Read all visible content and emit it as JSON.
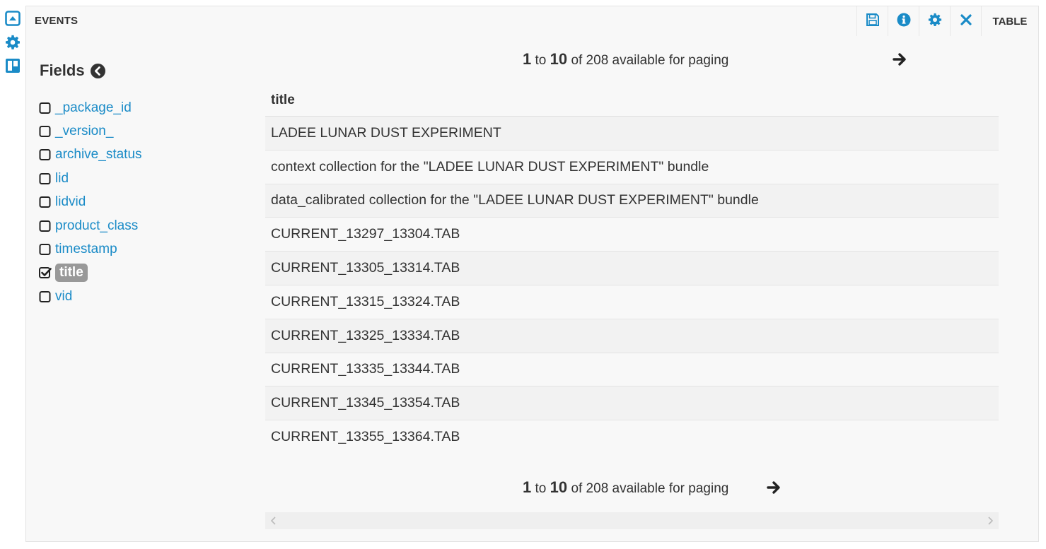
{
  "rail": {
    "icons": [
      "collapse-up-icon",
      "gear-icon",
      "layout-icon"
    ]
  },
  "panel": {
    "title": "EVENTS",
    "tools": {
      "save_icon": "save-icon",
      "info_icon": "info-icon",
      "settings_icon": "gear-icon",
      "close_icon": "close-icon",
      "view_label": "TABLE"
    }
  },
  "fields": {
    "heading": "Fields",
    "items": [
      {
        "label": "_package_id",
        "checked": false
      },
      {
        "label": "_version_",
        "checked": false
      },
      {
        "label": "archive_status",
        "checked": false
      },
      {
        "label": "lid",
        "checked": false
      },
      {
        "label": "lidvid",
        "checked": false
      },
      {
        "label": "product_class",
        "checked": false
      },
      {
        "label": "timestamp",
        "checked": false
      },
      {
        "label": "title",
        "checked": true
      },
      {
        "label": "vid",
        "checked": false
      }
    ]
  },
  "pager": {
    "from": "1",
    "to_word": "to",
    "to": "10",
    "suffix": "of 208 available for paging"
  },
  "table": {
    "columns": [
      "title"
    ],
    "rows": [
      "LADEE LUNAR DUST EXPERIMENT",
      "context collection for the \"LADEE LUNAR DUST EXPERIMENT\" bundle",
      "data_calibrated collection for the \"LADEE LUNAR DUST EXPERIMENT\" bundle",
      "CURRENT_13297_13304.TAB",
      "CURRENT_13305_13314.TAB",
      "CURRENT_13315_13324.TAB",
      "CURRENT_13325_13334.TAB",
      "CURRENT_13335_13344.TAB",
      "CURRENT_13345_13354.TAB",
      "CURRENT_13355_13364.TAB"
    ]
  },
  "colors": {
    "accent": "#1a8bc7",
    "selected_bg": "#999999",
    "panel_bg": "#f8f8f8"
  }
}
